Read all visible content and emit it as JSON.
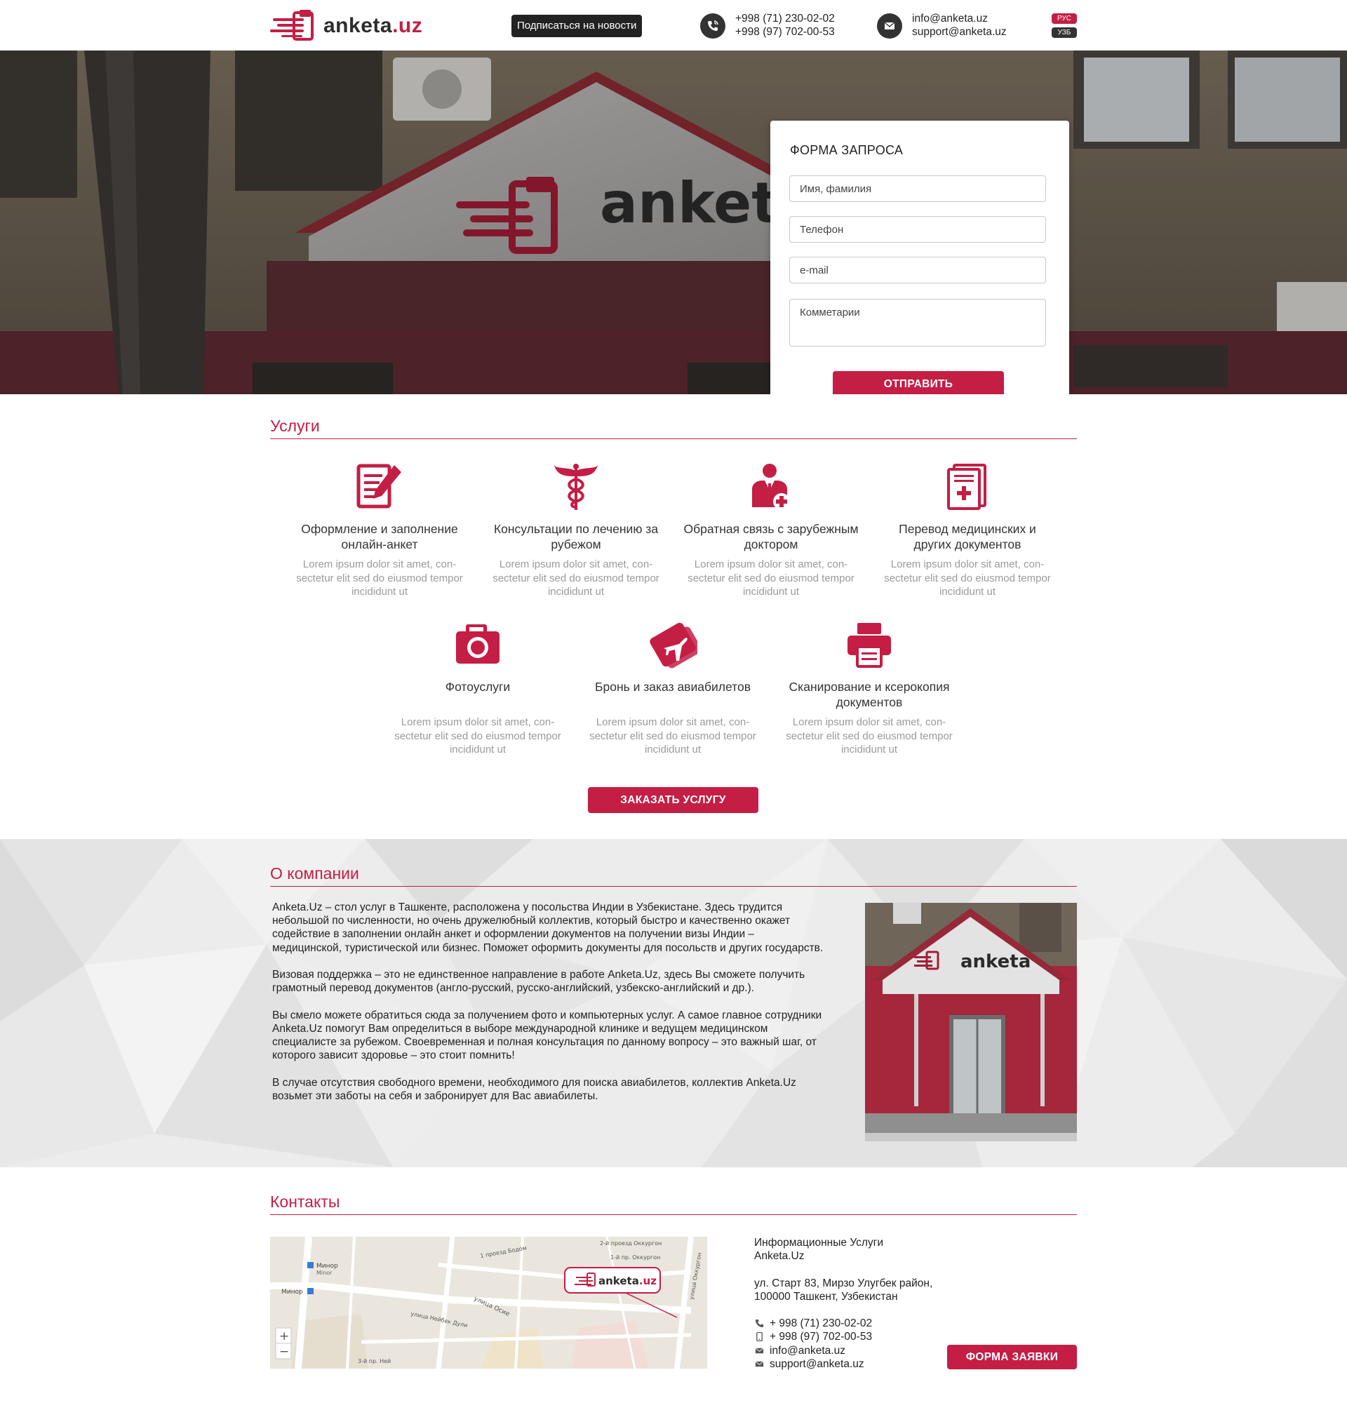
{
  "header": {
    "logo_text": "anketa",
    "logo_suffix": ".uz",
    "subscribe_label": "Подписаться на новости",
    "phones": [
      "+998 (71) 230-02-02",
      "+998 (97) 702-00-53"
    ],
    "emails": [
      "info@anketa.uz",
      "support@anketa.uz"
    ],
    "languages": [
      "РУС",
      "УЗБ"
    ]
  },
  "hero": {
    "sign_text": "anket"
  },
  "form": {
    "title": "ФОРМА ЗАПРОСА",
    "name_placeholder": "Имя, фамилия",
    "phone_placeholder": "Телефон",
    "email_placeholder": "e-mail",
    "comment_placeholder": "Комметарии",
    "submit_label": "ОТПРАВИТЬ"
  },
  "services": {
    "title": "Услуги",
    "items": [
      {
        "icon": "form-edit-icon",
        "title": "Оформление и заполнение онлайн-анкет",
        "desc": "Lorem ipsum dolor sit amet, con-sectetur elit sed do eiusmod tempor incididunt ut"
      },
      {
        "icon": "caduceus-icon",
        "title": "Консультации по лечению за рубежом",
        "desc": "Lorem ipsum dolor sit amet, con-sectetur elit sed do eiusmod tempor incididunt ut"
      },
      {
        "icon": "doctor-icon",
        "title": "Обратная связь с зарубежным доктором",
        "desc": "Lorem ipsum dolor sit amet, con-sectetur elit sed do eiusmod tempor incididunt ut"
      },
      {
        "icon": "medical-document-icon",
        "title": "Перевод медицинских и других документов",
        "desc": "Lorem ipsum dolor sit amet, con-sectetur elit sed do eiusmod tempor incididunt ut"
      },
      {
        "icon": "camera-icon",
        "title": "Фотоуслуги",
        "desc": "Lorem ipsum dolor sit amet, con-sectetur elit sed do eiusmod tempor incididunt ut"
      },
      {
        "icon": "plane-ticket-icon",
        "title": "Бронь и заказ авиабилетов",
        "desc": "Lorem ipsum dolor sit amet, con-sectetur elit sed do eiusmod tempor incididunt ut"
      },
      {
        "icon": "printer-icon",
        "title": "Сканирование и ксерокопия документов",
        "desc": "Lorem ipsum dolor sit amet, con-sectetur elit sed do eiusmod tempor incididunt ut"
      }
    ],
    "order_label": "ЗАКАЗАТЬ УСЛУГУ"
  },
  "about": {
    "title": "О компании",
    "paragraphs": [
      "Anketa.Uz – стол услуг в Ташкенте, расположена у посольства Индии в Узбекистане. Здесь трудится небольшой по численности, но очень дружелюбный коллектив, который быстро и качественно окажет содействие в заполнении онлайн анкет и оформлении документов на получении визы Индии – медицинской, туристической или бизнес. Поможет оформить документы для посольств и других государств.",
      "Визовая поддержка – это не единственное направление в работе Anketa.Uz, здесь Вы сможете получить грамотный перевод  документов (англо-русский, русско-английский, узбекско-английский и др.).",
      "Вы смело можете обратиться сюда за получением фото и компьютерных услуг. А самое главное сотрудники Anketa.Uz помогут Вам определиться в выборе международной клинике и ведущем медицинском специалисте за рубежом. Своевременная и полная консультация по данному вопросу – это важный шаг, от которого зависит здоровье – это стоит помнить!",
      "В случае отсутствия свободного времени, необходимого для поиска авиабилетов, коллектив Anketa.Uz возьмет эти заботы на себя и забронирует для Вас авиабилеты."
    ],
    "photo_sign": "anketa"
  },
  "contacts": {
    "title": "Контакты",
    "company": [
      "Информационные Услуги",
      "Anketa.Uz"
    ],
    "address": [
      "ул. Старт 83, Мирзо Улугбек район,",
      "100000 Ташкент, Узбекистан"
    ],
    "phone1": "+ 998 (71) 230-02-02",
    "phone2": "+ 998 (97) 702-00-53",
    "email1": "info@anketa.uz",
    "email2": "support@anketa.uz",
    "request_label": "ФОРМА ЗАЯВКИ",
    "map": {
      "labels": [
        "Минор",
        "Minor",
        "Минор",
        "1 проезд Бодом",
        "1-й пр. Оккургон",
        "2-й проезд Оккургон",
        "улица Оккургон",
        "улица Осие",
        "улица Нейбек Дули",
        "3-й пр. Ней"
      ],
      "marker_text": "anketa",
      "marker_suffix": ".uz",
      "zoom_in": "+",
      "zoom_out": "−"
    }
  },
  "colors": {
    "accent": "#c41e45",
    "dark": "#222222",
    "muted": "#9a9a9a"
  }
}
